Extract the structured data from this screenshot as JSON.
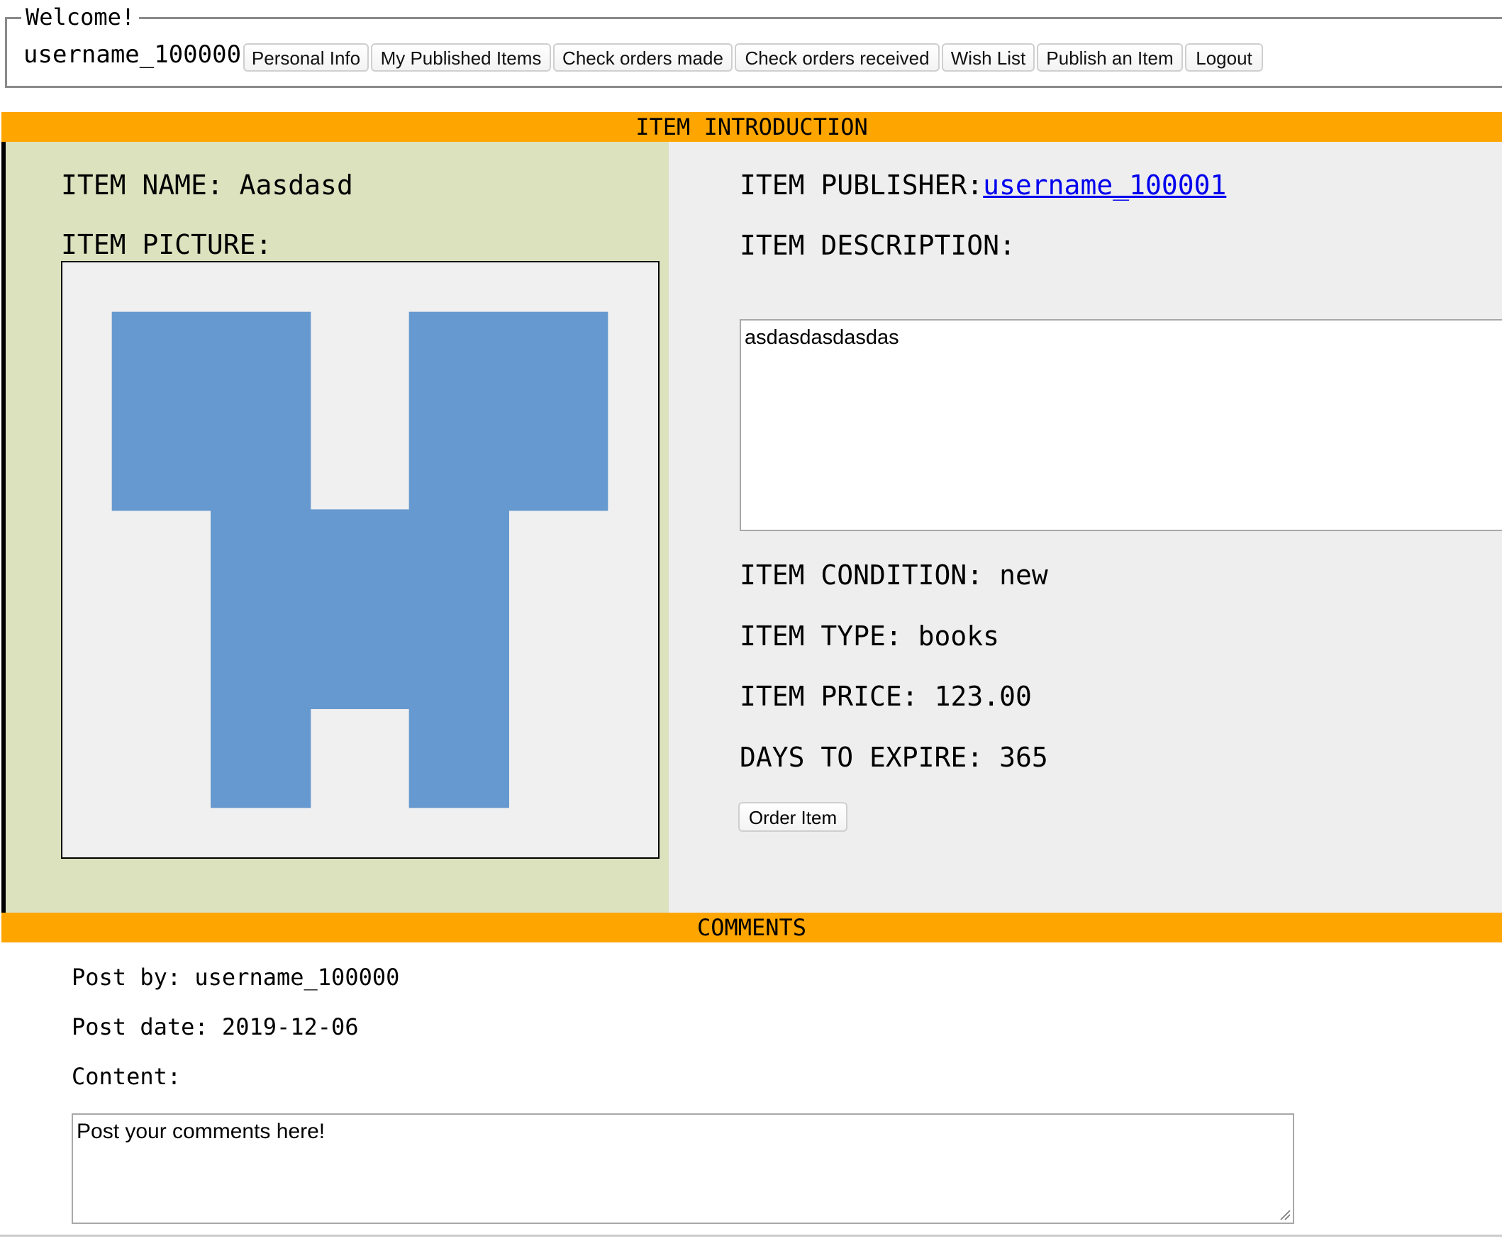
{
  "header": {
    "legend": "Welcome!",
    "username": "username_100000",
    "nav": [
      {
        "label": "Personal Info"
      },
      {
        "label": "My Published Items"
      },
      {
        "label": "Check orders made"
      },
      {
        "label": "Check orders received"
      },
      {
        "label": "Wish List"
      },
      {
        "label": "Publish an Item"
      },
      {
        "label": "Logout"
      }
    ]
  },
  "intro": {
    "section_title": "ITEM INTRODUCTION",
    "name_label": "ITEM NAME:",
    "name_value": "Aasdasd",
    "picture_label": "ITEM PICTURE:",
    "picture_icon": "identicon-image",
    "picture_color": "#6699cf",
    "picture_bg": "#f0f0f0",
    "publisher_label": "ITEM PUBLISHER:",
    "publisher_value": "username_100001",
    "description_label": "ITEM DESCRIPTION:",
    "description_value": "asdasdasdasdas",
    "condition_label": "ITEM CONDITION:",
    "condition_value": "new",
    "type_label": "ITEM TYPE:",
    "type_value": "books",
    "price_label": "ITEM PRICE:",
    "price_value": "123.00",
    "expire_label": "DAYS TO EXPIRE:",
    "expire_value": "365",
    "order_button": "Order Item"
  },
  "comments": {
    "section_title": "COMMENTS",
    "post_by_label": "Post by:",
    "post_by_value": "username_100000",
    "post_date_label": "Post date:",
    "post_date_value": "2019-12-06",
    "content_label": "Content:",
    "input_placeholder": "Post your comments here!"
  },
  "colors": {
    "section_bar": "#ffa500",
    "left_panel": "#dce2be",
    "right_panel": "#eeeeee",
    "link": "#0000ee"
  }
}
